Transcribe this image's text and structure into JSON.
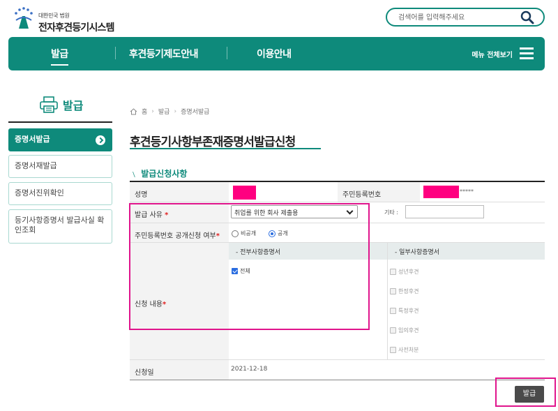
{
  "header": {
    "logo_small": "대한민국 법원",
    "logo_title": "전자후견등기시스템",
    "search_placeholder": "검색어를 입력해주세요"
  },
  "nav": {
    "items": [
      "발급",
      "후견등기제도안내",
      "이용안내"
    ],
    "menu_all": "메뉴 전체보기"
  },
  "sidebar": {
    "title": "발급",
    "items": [
      "증명서발급",
      "증명서재발급",
      "증명서진위확인",
      "등기사항증명서 발급사실 확인조회"
    ]
  },
  "breadcrumb": [
    "홈",
    "발급",
    "증명서발급"
  ],
  "page_title": "후견등기사항부존재증명서발급신청",
  "section_title": "발급신청사항",
  "form": {
    "name_label": "성명",
    "rrn_label": "주민등록번호",
    "rrn_mask": "*****",
    "reason_label": "발급 사유",
    "reason_value": "취업를 위한 회사 제출용",
    "etc_label": "기타 :",
    "disclosure_label": "주민등록번호 공개신청 여부",
    "disclosure_options": [
      "비공개",
      "공개"
    ],
    "disclosure_selected": "공개",
    "content_label": "신청 내용",
    "all_head": "- 전부사항증명서",
    "partial_head": "- 일부사항증명서",
    "all_options": [
      "전체"
    ],
    "partial_options": [
      "성년후견",
      "한정후견",
      "특정후견",
      "임의후견",
      "사전처분"
    ],
    "date_label": "신청일",
    "date_value": "2021-12-18",
    "required_mark": "*"
  },
  "issue_button": "발급",
  "colors": {
    "brand": "#0e8a7b",
    "highlight": "#e0148c",
    "redaction": "#ff0080"
  }
}
